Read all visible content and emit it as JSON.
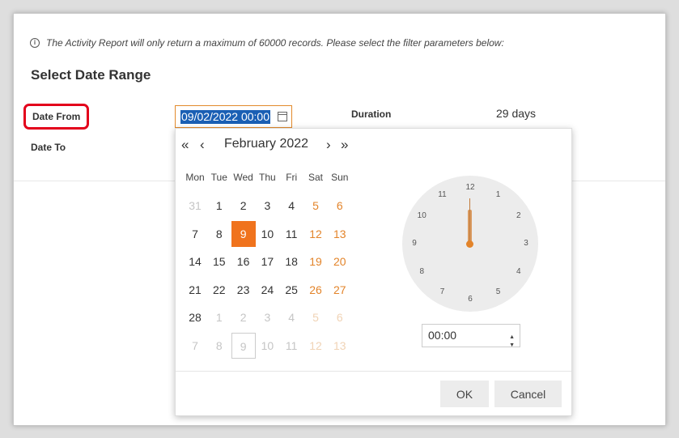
{
  "info_text": "The Activity Report will only return a maximum of 60000 records. Please select the filter parameters below:",
  "info_icon": "i",
  "section_title": "Select Date Range",
  "labels": {
    "date_from": "Date From",
    "date_to": "Date To",
    "duration": "Duration"
  },
  "duration_value": "29 days",
  "date_from_value": "09/02/2022 00:00",
  "calendar": {
    "nav": {
      "prev_year": "«",
      "prev_month": "‹",
      "next_month": "›",
      "next_year": "»"
    },
    "month_label": "February 2022",
    "weekdays": [
      "Mon",
      "Tue",
      "Wed",
      "Thu",
      "Fri",
      "Sat",
      "Sun"
    ],
    "weeks": [
      [
        "31",
        "1",
        "2",
        "3",
        "4",
        "5",
        "6"
      ],
      [
        "7",
        "8",
        "9",
        "10",
        "11",
        "12",
        "13"
      ],
      [
        "14",
        "15",
        "16",
        "17",
        "18",
        "19",
        "20"
      ],
      [
        "21",
        "22",
        "23",
        "24",
        "25",
        "26",
        "27"
      ],
      [
        "28",
        "1",
        "2",
        "3",
        "4",
        "5",
        "6"
      ],
      [
        "7",
        "8",
        "9",
        "10",
        "11",
        "12",
        "13"
      ]
    ],
    "selected_day": "9"
  },
  "clock": {
    "numbers": [
      "12",
      "1",
      "2",
      "3",
      "4",
      "5",
      "6",
      "7",
      "8",
      "9",
      "10",
      "11"
    ]
  },
  "time_value": "00:00",
  "time_spin": {
    "up": "▲",
    "down": "▼"
  },
  "buttons": {
    "ok": "OK",
    "cancel": "Cancel"
  },
  "colors": {
    "accent": "#f0731d",
    "weekend": "#e3842a",
    "selection": "#1a5fb4",
    "highlight_border": "#e3001b"
  }
}
